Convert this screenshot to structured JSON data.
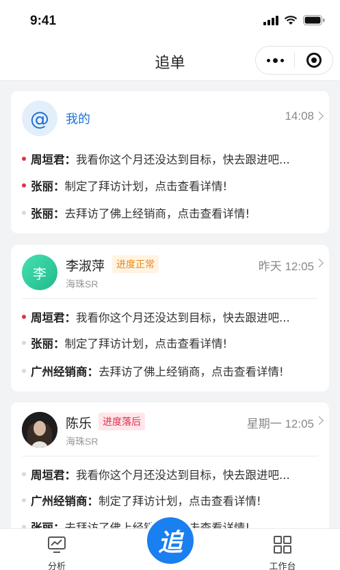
{
  "status_bar": {
    "time": "9:41"
  },
  "nav": {
    "title": "追单"
  },
  "cards": [
    {
      "name": "我的",
      "time": "14:08",
      "messages": [
        {
          "unread": true,
          "sender": "周垣君：",
          "text": "我看你这个月还没达到目标，快去跟进吧..."
        },
        {
          "unread": true,
          "sender": "张丽：",
          "text": "制定了拜访计划，点击查看详情!"
        },
        {
          "unread": false,
          "sender": "张丽：",
          "text": "去拜访了佛上经销商，点击查看详情!"
        }
      ]
    },
    {
      "name": "李淑萍",
      "avatar_text": "李",
      "tag": "进度正常",
      "subtitle": "海珠SR",
      "time": "昨天  12:05",
      "messages": [
        {
          "unread": true,
          "sender": "周垣君：",
          "text": "我看你这个月还没达到目标，快去跟进吧..."
        },
        {
          "unread": false,
          "sender": "张丽：",
          "text": "制定了拜访计划，点击查看详情!"
        },
        {
          "unread": false,
          "sender": "广州经销商：",
          "text": "去拜访了佛上经销商，点击查看详情!"
        }
      ]
    },
    {
      "name": "陈乐",
      "tag": "进度落后",
      "subtitle": "海珠SR",
      "time": "星期一  12:05",
      "messages": [
        {
          "unread": false,
          "sender": "周垣君：",
          "text": "我看你这个月还没达到目标，快去跟进吧..."
        },
        {
          "unread": false,
          "sender": "广州经销商：",
          "text": "制定了拜访计划，点击查看详情!"
        },
        {
          "unread": false,
          "sender": "张丽：",
          "text": "去拜访了佛上经销商，点击查看详情!"
        }
      ]
    }
  ],
  "tab_bar": {
    "analysis_label": "分析",
    "center_label": "追",
    "workbench_label": "工作台"
  },
  "colors": {
    "accent": "#1a7ff0",
    "unread_dot": "#e0314b",
    "tag_normal": "#e88a1a",
    "tag_behind": "#e0314b"
  }
}
